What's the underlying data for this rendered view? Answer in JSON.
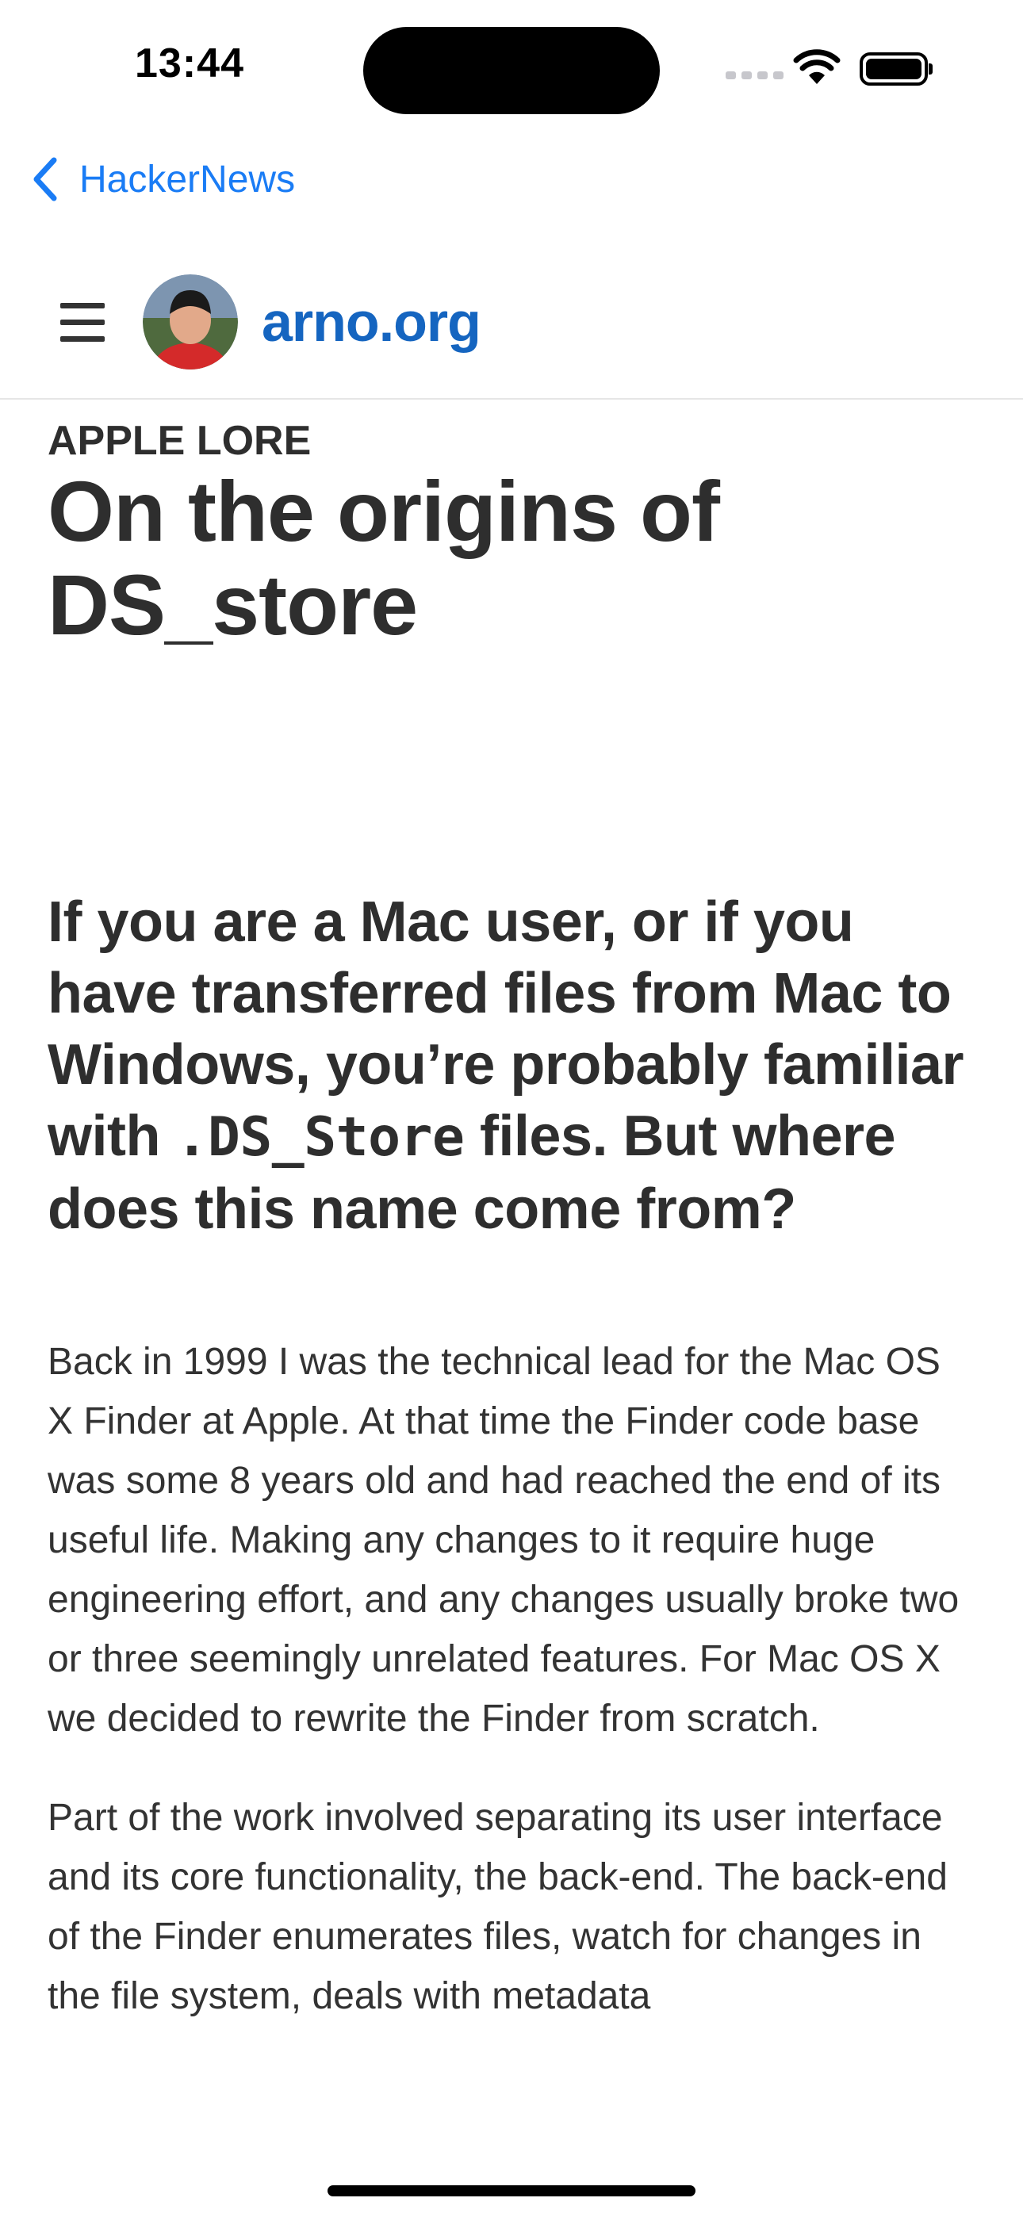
{
  "status_bar": {
    "time": "13:44"
  },
  "nav": {
    "back_label": "HackerNews"
  },
  "site": {
    "name": "arno.org"
  },
  "article": {
    "category": "APPLE LORE",
    "title": "On the origins of DS_store",
    "lead_before": "If you are a Mac user, or if you have transferred files from Mac to Windows, you’re probably familiar with ",
    "lead_code": ".DS_Store",
    "lead_after": " files. But where does this name come from?",
    "paragraphs": [
      "Back in 1999 I was the technical lead for the Mac OS X Finder at Apple. At that time the Finder code base was some 8 years old and had reached the end of its useful life. Making any changes to it require huge engineering effort, and any changes usually broke two or three seemingly unrelated features. For Mac OS X we decided to rewrite the Finder from scratch.",
      "Part of the work involved separating its user interface and its core functionality, the back-end. The back-end of the Finder enumerates files, watch for changes in the file system, deals with metadata"
    ]
  }
}
